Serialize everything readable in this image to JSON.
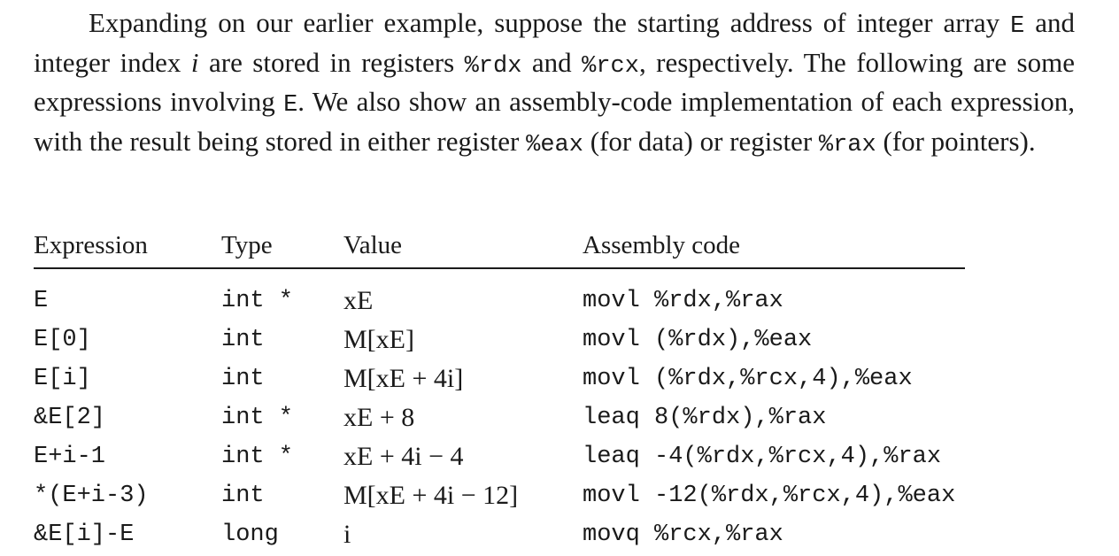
{
  "paragraph": {
    "part1": "Expanding on our earlier example, suppose the starting address of integer array ",
    "code_E": "E",
    "part2": " and integer index ",
    "math_i": "i",
    "part3": " are stored in registers ",
    "code_rdx": "%rdx",
    "part4": " and ",
    "code_rcx": "%rcx",
    "part5": ", respectively. The following are some expressions involving ",
    "code_E2": "E",
    "part6": ". We also show an assembly-code implementation of each expression, with the result being stored in either register ",
    "code_eax": "%eax",
    "part7": " (for data) or register ",
    "code_rax": "%rax",
    "part8": " (for pointers)."
  },
  "table": {
    "headers": {
      "expression": "Expression",
      "type": "Type",
      "value": "Value",
      "assembly": "Assembly code"
    },
    "rows": [
      {
        "expression": "E",
        "type": "int *",
        "value": "xE",
        "assembly": "movl %rdx,%rax"
      },
      {
        "expression": "E[0]",
        "type": "int",
        "value": "M[xE]",
        "assembly": "movl (%rdx),%eax"
      },
      {
        "expression": "E[i]",
        "type": "int",
        "value": "M[xE + 4i]",
        "assembly": "movl (%rdx,%rcx,4),%eax"
      },
      {
        "expression": "&E[2]",
        "type": "int *",
        "value": "xE + 8",
        "assembly": "leaq 8(%rdx),%rax"
      },
      {
        "expression": "E+i-1",
        "type": "int *",
        "value": "xE + 4i − 4",
        "assembly": "leaq -4(%rdx,%rcx,4),%rax"
      },
      {
        "expression": "*(E+i-3)",
        "type": "int",
        "value": "M[xE + 4i − 12]",
        "assembly": "movl -12(%rdx,%rcx,4),%eax"
      },
      {
        "expression": "&E[i]-E",
        "type": "long",
        "value": "i",
        "assembly": "movq %rcx,%rax"
      }
    ]
  }
}
